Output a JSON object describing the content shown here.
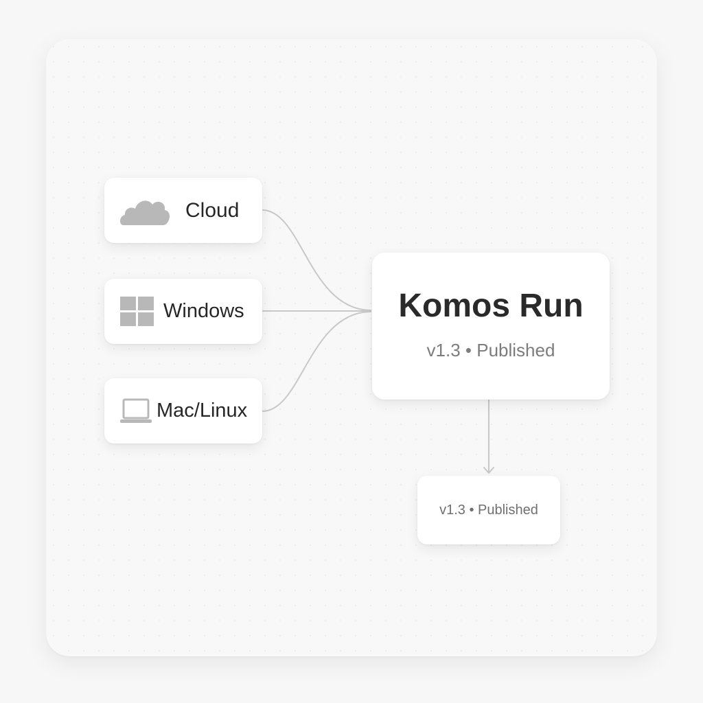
{
  "diagram": {
    "sources": [
      {
        "label": "Cloud",
        "icon": "cloud-icon"
      },
      {
        "label": "Windows",
        "icon": "windows-logo-icon"
      },
      {
        "label": "Mac/Linux",
        "icon": "laptop-icon"
      }
    ],
    "main": {
      "title": "Komos Run",
      "subtitle": "v1.3 • Published"
    },
    "output": {
      "label": "v1.3 • Published"
    },
    "colors": {
      "background": "#f8f8f8",
      "node": "#ffffff",
      "connector": "#c8c8c8",
      "icon": "#b5b5b5",
      "title_text": "#2a2a2a",
      "muted_text": "#7c7c7c"
    }
  }
}
